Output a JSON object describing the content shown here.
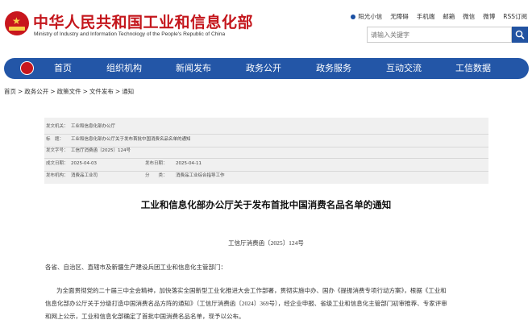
{
  "header": {
    "site_title": "中华人民共和国工业和信息化部",
    "site_subtitle": "Ministry of Industry and Information Technology of the People's Republic of China",
    "top_links": [
      "阳光小信",
      "无障碍",
      "手机端",
      "邮箱",
      "微信",
      "微博",
      "RSS订阅"
    ],
    "search_placeholder": "请输入关键字"
  },
  "nav": {
    "items": [
      "首页",
      "组织机构",
      "新闻发布",
      "政务公开",
      "政务服务",
      "互动交流",
      "工信数据"
    ]
  },
  "breadcrumb": {
    "items": [
      "首页",
      "政务公开",
      "政策文件",
      "文件发布",
      "通知"
    ],
    "separator": ">"
  },
  "meta": {
    "issuer_label": "发文机关：",
    "issuer": "工业和信息化部办公厅",
    "title_label": "标　题：",
    "title": "工业和信息化部办公厅关于发布首批中国消费名品名单的通知",
    "doc_no_label": "发文字号：",
    "doc_no": "工信厅消费函〔2025〕124号",
    "written_label": "成文日期：",
    "written_date": "2025-04-03",
    "published_label": "发布日期：",
    "published_date": "2025-04-11",
    "dept_label": "发布机构：",
    "dept": "消费品工业司",
    "category_label": "分　　类：",
    "category": "消费品工业综合指导工作"
  },
  "article": {
    "title": "工业和信息化部办公厅关于发布首批中国消费名品名单的通知",
    "doc_number": "工信厅消费函〔2025〕124号",
    "recipients": "各省、自治区、直辖市及新疆生产建设兵团工业和信息化主管部门：",
    "body_lines": [
      "为全面贯彻党的二十届三中全会精神，加快落实全国新型工业化推进大会工作部署，贯彻实施中办、国办《提振消费专项行动方案》，根据《工业和",
      "信息化部办公厅关于分级打造中国消费名品方阵的通知》（工信厅消费函〔2024〕369号），经企业申报、省级工业和信息化主管部门初审推荐、专家评审",
      "和网上公示，工业和信息化部确定了首批中国消费名品名单，现予以公布。"
    ]
  },
  "colors": {
    "brand_red": "#c4161c",
    "nav_blue": "#2356a7",
    "search_blue": "#2253a1"
  }
}
